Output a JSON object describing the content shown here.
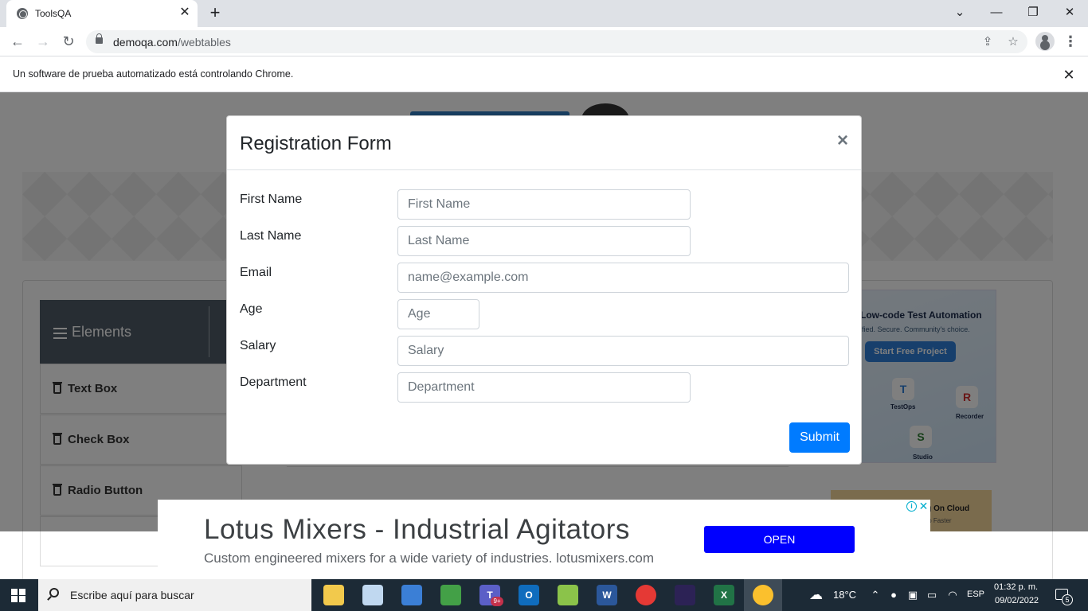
{
  "browser": {
    "tab_title": "ToolsQA",
    "tab_close": "✕",
    "new_tab": "+",
    "window_controls": {
      "dropdown": "⌄",
      "minimize": "—",
      "restore": "❐",
      "close": "✕"
    },
    "nav": {
      "back": "←",
      "forward": "→",
      "reload": "↻"
    },
    "url_host": "demoqa.com",
    "url_path": "/webtables",
    "omnibox_icons": [
      "share-icon",
      "star-icon"
    ],
    "infobar_text": "Un software de prueba automatizado está controlando Chrome.",
    "infobar_close": "✕",
    "menu": "⋮"
  },
  "page": {
    "sidebar": {
      "group_title": "Elements",
      "items": [
        {
          "label": "Text Box"
        },
        {
          "label": "Check Box"
        },
        {
          "label": "Radio Button"
        }
      ]
    },
    "right_ad": {
      "title": "Low-code Test Automation",
      "subtitle": "ified. Secure. Community's choice.",
      "button": "Start Free Project",
      "tiles": [
        "T",
        "R",
        "S"
      ],
      "tags": [
        "TestOps",
        "Recorder",
        "Studio"
      ]
    },
    "right_ad2": {
      "title": "ting On Cloud",
      "subtitle": "hip Faster"
    }
  },
  "modal": {
    "title": "Registration Form",
    "close": "×",
    "fields": [
      {
        "label": "First Name",
        "placeholder": "First Name"
      },
      {
        "label": "Last Name",
        "placeholder": "Last Name"
      },
      {
        "label": "Email",
        "placeholder": "name@example.com"
      },
      {
        "label": "Age",
        "placeholder": "Age"
      },
      {
        "label": "Salary",
        "placeholder": "Salary"
      },
      {
        "label": "Department",
        "placeholder": "Department"
      }
    ],
    "submit": "Submit"
  },
  "bottom_ad": {
    "title": "Lotus Mixers - Industrial Agitators",
    "subtitle": "Custom engineered mixers for a wide variety of industries. lotusmixers.com",
    "button": "OPEN",
    "adchoices": "i",
    "close": "✕"
  },
  "taskbar": {
    "search_placeholder": "Escribe aquí para buscar",
    "apps": [
      {
        "name": "file-explorer",
        "glyph": "",
        "color": "#f2c94c"
      },
      {
        "name": "paint",
        "glyph": "",
        "color": "#c0d8f0"
      },
      {
        "name": "app-3",
        "glyph": "",
        "color": "#3b7fd6"
      },
      {
        "name": "app-4",
        "glyph": "",
        "color": "#43a047"
      },
      {
        "name": "teams",
        "glyph": "T",
        "color": "#5b5fc7"
      },
      {
        "name": "outlook",
        "glyph": "O",
        "color": "#0f6cbd"
      },
      {
        "name": "app-7",
        "glyph": "",
        "color": "#8bc34a"
      },
      {
        "name": "word",
        "glyph": "W",
        "color": "#2b579a"
      },
      {
        "name": "chrome",
        "glyph": "",
        "color": "#e53935"
      },
      {
        "name": "eclipse",
        "glyph": "",
        "color": "#2c2255"
      },
      {
        "name": "excel",
        "glyph": "X",
        "color": "#217346"
      },
      {
        "name": "chrome-active",
        "glyph": "",
        "color": "#fbc02d"
      }
    ],
    "teams_badge": "9+",
    "weather_icon": "☁",
    "temperature": "18°C",
    "language": "ESP",
    "time": "01:32 p. m.",
    "date": "09/02/2022",
    "notifications": "5"
  }
}
